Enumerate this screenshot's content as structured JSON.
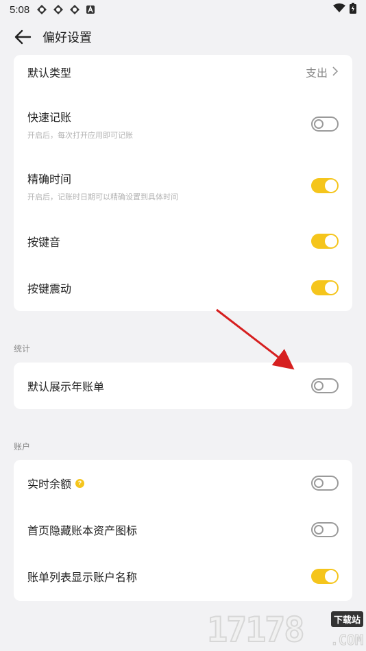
{
  "status_bar": {
    "time": "5:08",
    "icons": [
      "app-icon",
      "app-icon",
      "app-icon",
      "a-icon"
    ],
    "right_icons": [
      "wifi-icon",
      "battery-icon"
    ]
  },
  "header": {
    "title": "偏好设置",
    "back_icon": "arrow-left-icon"
  },
  "sections": {
    "general": {
      "items": [
        {
          "label": "默认类型",
          "value": "支出",
          "control": "chevron-right-icon"
        },
        {
          "label": "快速记账",
          "subtitle": "开启后，每次打开应用即可记账",
          "toggle": false
        },
        {
          "label": "精确时间",
          "subtitle": "开启后，记账时日期可以精确设置到具体时间",
          "toggle": true
        },
        {
          "label": "按键音",
          "toggle": true
        },
        {
          "label": "按键震动",
          "toggle": true
        }
      ]
    },
    "stats": {
      "title": "统计",
      "items": [
        {
          "label": "默认展示年账单",
          "toggle": false
        }
      ]
    },
    "account": {
      "title": "账户",
      "items": [
        {
          "label": "实时余额",
          "help_icon": "?",
          "toggle": false
        },
        {
          "label": "首页隐藏账本资产图标",
          "toggle": false
        },
        {
          "label": "账单列表显示账户名称",
          "toggle": true
        }
      ]
    }
  },
  "watermark": {
    "digits": "17178",
    "site": "下载站",
    "com": ".COM"
  },
  "colors": {
    "accent": "#f5c51c",
    "background": "#f2f2f4",
    "arrow": "#d61f1f"
  }
}
